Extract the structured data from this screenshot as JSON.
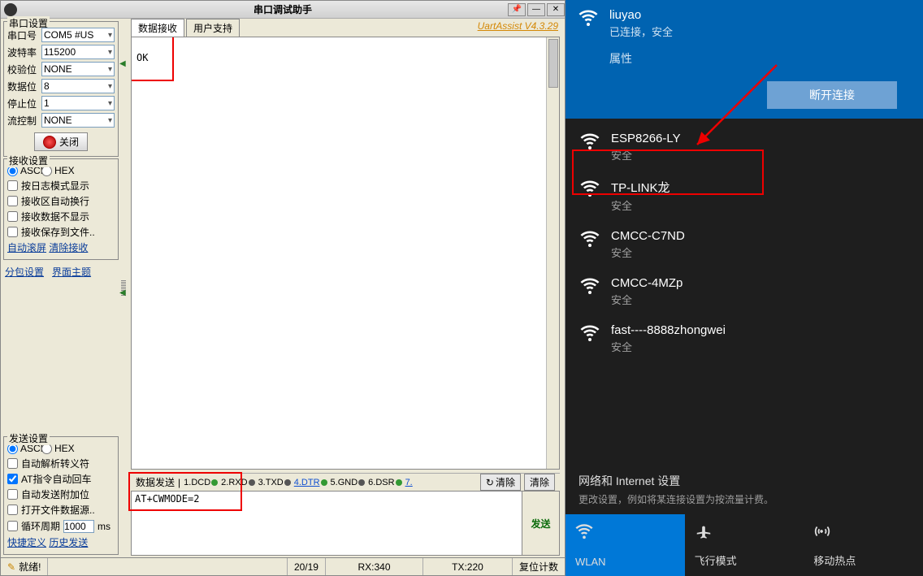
{
  "titlebar": {
    "title": "串口调试助手"
  },
  "tabs": {
    "recv": "数据接收",
    "support": "用户支持",
    "version": "UartAssist V4.3.29"
  },
  "port_settings": {
    "legend": "串口设置",
    "port_label": "串口号",
    "port_value": "COM5 #US",
    "baud_label": "波特率",
    "baud_value": "115200",
    "parity_label": "校验位",
    "parity_value": "NONE",
    "data_label": "数据位",
    "data_value": "8",
    "stop_label": "停止位",
    "stop_value": "1",
    "flow_label": "流控制",
    "flow_value": "NONE",
    "close_btn": "关闭"
  },
  "recv_settings": {
    "legend": "接收设置",
    "ascii": "ASCII",
    "hex": "HEX",
    "log_mode": "按日志模式显示",
    "auto_wrap": "接收区自动换行",
    "hide_recv": "接收数据不显示",
    "save_file": "接收保存到文件..",
    "auto_scroll": "自动滚屏",
    "clear_recv": "清除接收"
  },
  "misc_links": {
    "pkg": "分包设置",
    "theme": "界面主题"
  },
  "send_settings": {
    "legend": "发送设置",
    "ascii": "ASCII",
    "hex": "HEX",
    "parse_escape": "自动解析转义符",
    "at_autocr": "AT指令自动回车",
    "append_bits": "自动发送附加位",
    "open_file": "打开文件数据源..",
    "cycle_label": "循环周期",
    "cycle_value": "1000",
    "cycle_unit": "ms",
    "shortcut": "快捷定义",
    "history": "历史发送"
  },
  "recv_text": "OK",
  "send_header": {
    "label": "数据发送",
    "sig1": "1.DCD",
    "sig2": "2.RXD",
    "sig3": "3.TXD",
    "sig4": "4.DTR",
    "sig5": "5.GND",
    "sig6": "6.DSR",
    "sig7": "7.",
    "clear1": "清除",
    "clear2": "清除"
  },
  "send_text": "AT+CWMODE=2",
  "send_btn": "发送",
  "statusbar": {
    "ready": "就绪!",
    "count": "20/19",
    "rx": "RX:340",
    "tx": "TX:220",
    "reset": "复位计数"
  },
  "wifi": {
    "connected": {
      "name": "liuyao",
      "status": "已连接，安全"
    },
    "props": "属性",
    "disconnect": "断开连接",
    "list": [
      {
        "name": "ESP8266-LY",
        "sub": "安全"
      },
      {
        "name": "TP-LINK龙",
        "sub": "安全"
      },
      {
        "name": "CMCC-C7ND",
        "sub": "安全"
      },
      {
        "name": "CMCC-4MZp",
        "sub": "安全"
      },
      {
        "name": "fast----8888zhongwei",
        "sub": "安全"
      }
    ],
    "settings_h": "网络和 Internet 设置",
    "settings_s": "更改设置，例如将某连接设置为按流量计费。",
    "tile_wlan": "WLAN",
    "tile_airplane": "飞行模式",
    "tile_hotspot": "移动热点"
  }
}
